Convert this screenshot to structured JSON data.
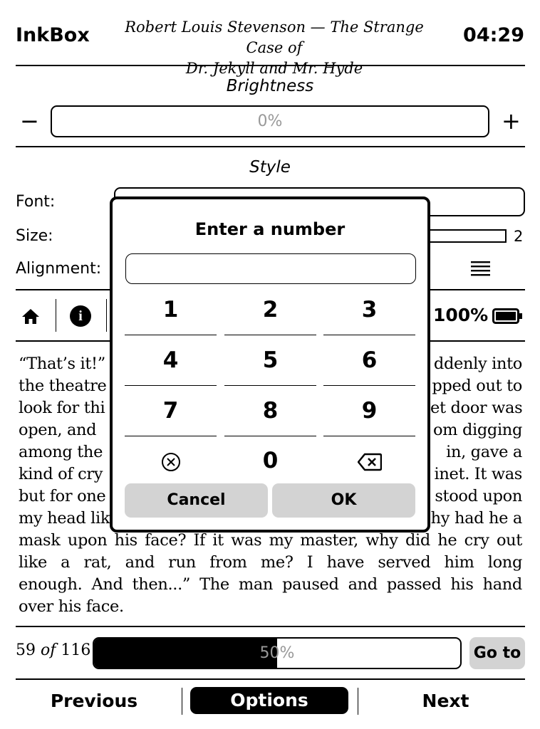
{
  "header": {
    "app_name": "InkBox",
    "book_title_line1": "Robert Louis Stevenson — The Strange Case of",
    "book_title_line2": "Dr. Jekyll and Mr. Hyde",
    "clock": "04:29"
  },
  "brightness": {
    "title": "Brightness",
    "decrease_label": "−",
    "increase_label": "+",
    "value_text": "0%",
    "level_percent": 0
  },
  "style": {
    "title": "Style",
    "font_label": "Font:",
    "size_label": "Size:",
    "size_value": "2",
    "alignment_label": "Alignment:",
    "alignment_icon": "align-justify-icon"
  },
  "toolbar": {
    "home_icon": "home-icon",
    "info_icon": "info-icon",
    "info_glyph": "i",
    "battery_percent": "100%",
    "battery_icon": "battery-full-icon"
  },
  "text": {
    "lines": [
      "“That’s it!” ",
      "the theatre",
      "look for thi",
      "open, and ",
      "among the",
      "kind of cry",
      "but for one",
      "my head lik",
      "mask upon his face? If it was my master, why did he cry out",
      "like a rat, and run from me? I have served him long",
      "enough. And then...” The man paused and passed his hand",
      "over his face."
    ],
    "right_fragments": [
      "ddenly into",
      "pped out to",
      "et door was",
      "om digging",
      "in, gave a",
      "inet. It was",
      "stood upon",
      "hy had he a"
    ]
  },
  "footer": {
    "page_current": "59",
    "page_of": "of",
    "page_total": "116",
    "progress_text": "50%",
    "progress_fraction": 0.5,
    "goto_label": "Go to",
    "previous_label": "Previous",
    "options_label": "Options",
    "next_label": "Next"
  },
  "dialog": {
    "title": "Enter a number",
    "input_value": "",
    "keys": [
      "1",
      "2",
      "3",
      "4",
      "5",
      "6",
      "7",
      "8",
      "9",
      "clear",
      "0",
      "backspace"
    ],
    "cancel_label": "Cancel",
    "ok_label": "OK"
  }
}
